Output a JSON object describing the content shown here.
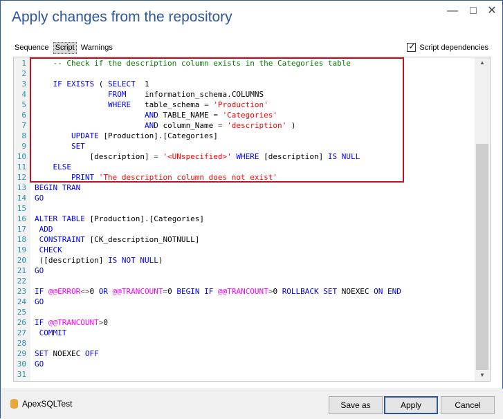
{
  "window": {
    "title": "Apply changes from the repository",
    "controls": [
      "minimize-icon",
      "maximize-icon",
      "close-icon"
    ]
  },
  "tabs": [
    {
      "label": "Sequence",
      "active": false
    },
    {
      "label": "Script",
      "active": true
    },
    {
      "label": "Warnings",
      "active": false
    }
  ],
  "script_dependencies": {
    "label": "Script dependencies",
    "checked": true
  },
  "editor": {
    "lines": [
      {
        "n": "1",
        "segs": [
          [
            "cm",
            "    -- Check if the description column exists in the Categories table"
          ]
        ]
      },
      {
        "n": "2",
        "segs": []
      },
      {
        "n": "3",
        "segs": [
          [
            "",
            "    "
          ],
          [
            "kw",
            "IF EXISTS"
          ],
          [
            "",
            " ( "
          ],
          [
            "kw",
            "SELECT"
          ],
          [
            "",
            "  1"
          ]
        ]
      },
      {
        "n": "4",
        "segs": [
          [
            "",
            "                "
          ],
          [
            "kw",
            "FROM"
          ],
          [
            "",
            "    information_schema.COLUMNS"
          ]
        ]
      },
      {
        "n": "5",
        "segs": [
          [
            "",
            "                "
          ],
          [
            "kw",
            "WHERE"
          ],
          [
            "",
            "   table_schema "
          ],
          [
            "op",
            "="
          ],
          [
            "",
            " "
          ],
          [
            "str",
            "'Production'"
          ]
        ]
      },
      {
        "n": "6",
        "segs": [
          [
            "",
            "                        "
          ],
          [
            "kw",
            "AND"
          ],
          [
            "",
            " TABLE_NAME "
          ],
          [
            "op",
            "="
          ],
          [
            "",
            " "
          ],
          [
            "str",
            "'Categories'"
          ]
        ]
      },
      {
        "n": "7",
        "segs": [
          [
            "",
            "                        "
          ],
          [
            "kw",
            "AND"
          ],
          [
            "",
            " column_Name "
          ],
          [
            "op",
            "="
          ],
          [
            "",
            " "
          ],
          [
            "str",
            "'description'"
          ],
          [
            "",
            " )"
          ]
        ]
      },
      {
        "n": "8",
        "segs": [
          [
            "",
            "        "
          ],
          [
            "kw",
            "UPDATE"
          ],
          [
            "",
            " [Production].[Categories]"
          ]
        ]
      },
      {
        "n": "9",
        "segs": [
          [
            "",
            "        "
          ],
          [
            "kw",
            "SET"
          ]
        ]
      },
      {
        "n": "10",
        "segs": [
          [
            "",
            "            [description] "
          ],
          [
            "op",
            "="
          ],
          [
            "",
            " "
          ],
          [
            "str",
            "'<UNspecified>'"
          ],
          [
            "",
            " "
          ],
          [
            "kw",
            "WHERE"
          ],
          [
            "",
            " [description] "
          ],
          [
            "kw",
            "IS NULL"
          ]
        ]
      },
      {
        "n": "11",
        "segs": [
          [
            "",
            "    "
          ],
          [
            "kw",
            "ELSE"
          ]
        ]
      },
      {
        "n": "12",
        "segs": [
          [
            "",
            "        "
          ],
          [
            "kw",
            "PRINT"
          ],
          [
            "",
            " "
          ],
          [
            "str",
            "'The description column does not exist'"
          ]
        ]
      },
      {
        "n": "13",
        "segs": [
          [
            "kw",
            "BEGIN TRAN"
          ]
        ]
      },
      {
        "n": "14",
        "segs": [
          [
            "kw",
            "GO"
          ]
        ]
      },
      {
        "n": "15",
        "segs": []
      },
      {
        "n": "16",
        "segs": [
          [
            "kw",
            "ALTER TABLE"
          ],
          [
            "",
            " [Production].[Categories]"
          ]
        ]
      },
      {
        "n": "17",
        "segs": [
          [
            "",
            " "
          ],
          [
            "kw",
            "ADD"
          ]
        ]
      },
      {
        "n": "18",
        "segs": [
          [
            "",
            " "
          ],
          [
            "kw",
            "CONSTRAINT"
          ],
          [
            "",
            " [CK_description_NOTNULL]"
          ]
        ]
      },
      {
        "n": "19",
        "segs": [
          [
            "",
            " "
          ],
          [
            "kw",
            "CHECK"
          ]
        ]
      },
      {
        "n": "20",
        "segs": [
          [
            "",
            " ([description] "
          ],
          [
            "kw",
            "IS NOT NULL"
          ],
          [
            "",
            ")"
          ]
        ]
      },
      {
        "n": "21",
        "segs": [
          [
            "kw",
            "GO"
          ]
        ]
      },
      {
        "n": "22",
        "segs": []
      },
      {
        "n": "23",
        "segs": [
          [
            "kw",
            "IF"
          ],
          [
            "",
            " "
          ],
          [
            "fn",
            "@@ERROR"
          ],
          [
            "op",
            "<>"
          ],
          [
            "",
            "0 "
          ],
          [
            "kw",
            "OR"
          ],
          [
            "",
            " "
          ],
          [
            "fn",
            "@@TRANCOUNT"
          ],
          [
            "op",
            "="
          ],
          [
            "",
            "0 "
          ],
          [
            "kw",
            "BEGIN IF"
          ],
          [
            "",
            " "
          ],
          [
            "fn",
            "@@TRANCOUNT"
          ],
          [
            "op",
            ">"
          ],
          [
            "",
            "0 "
          ],
          [
            "kw",
            "ROLLBACK SET"
          ],
          [
            "",
            " NOEXEC "
          ],
          [
            "kw",
            "ON END"
          ]
        ]
      },
      {
        "n": "24",
        "segs": [
          [
            "kw",
            "GO"
          ]
        ]
      },
      {
        "n": "25",
        "segs": []
      },
      {
        "n": "26",
        "segs": [
          [
            "kw",
            "IF"
          ],
          [
            "",
            " "
          ],
          [
            "fn",
            "@@TRANCOUNT"
          ],
          [
            "op",
            ">"
          ],
          [
            "",
            "0"
          ]
        ]
      },
      {
        "n": "27",
        "segs": [
          [
            "",
            " "
          ],
          [
            "kw",
            "COMMIT"
          ]
        ]
      },
      {
        "n": "28",
        "segs": []
      },
      {
        "n": "29",
        "segs": [
          [
            "kw",
            "SET"
          ],
          [
            "",
            " NOEXEC "
          ],
          [
            "kw",
            "OFF"
          ]
        ]
      },
      {
        "n": "30",
        "segs": [
          [
            "kw",
            "GO"
          ]
        ]
      },
      {
        "n": "31",
        "segs": []
      }
    ]
  },
  "footer": {
    "brand": "ApexSQLTest",
    "brand_icon": "database-icon",
    "save_as": "Save as",
    "apply": "Apply",
    "cancel": "Cancel"
  },
  "colors": {
    "title": "#2b579a",
    "keyword": "#0000ff",
    "function": "#ff00ff",
    "string": "#ff0000",
    "comment": "#008000",
    "line_number": "#2b91af",
    "highlight_box": "#c0121e"
  }
}
